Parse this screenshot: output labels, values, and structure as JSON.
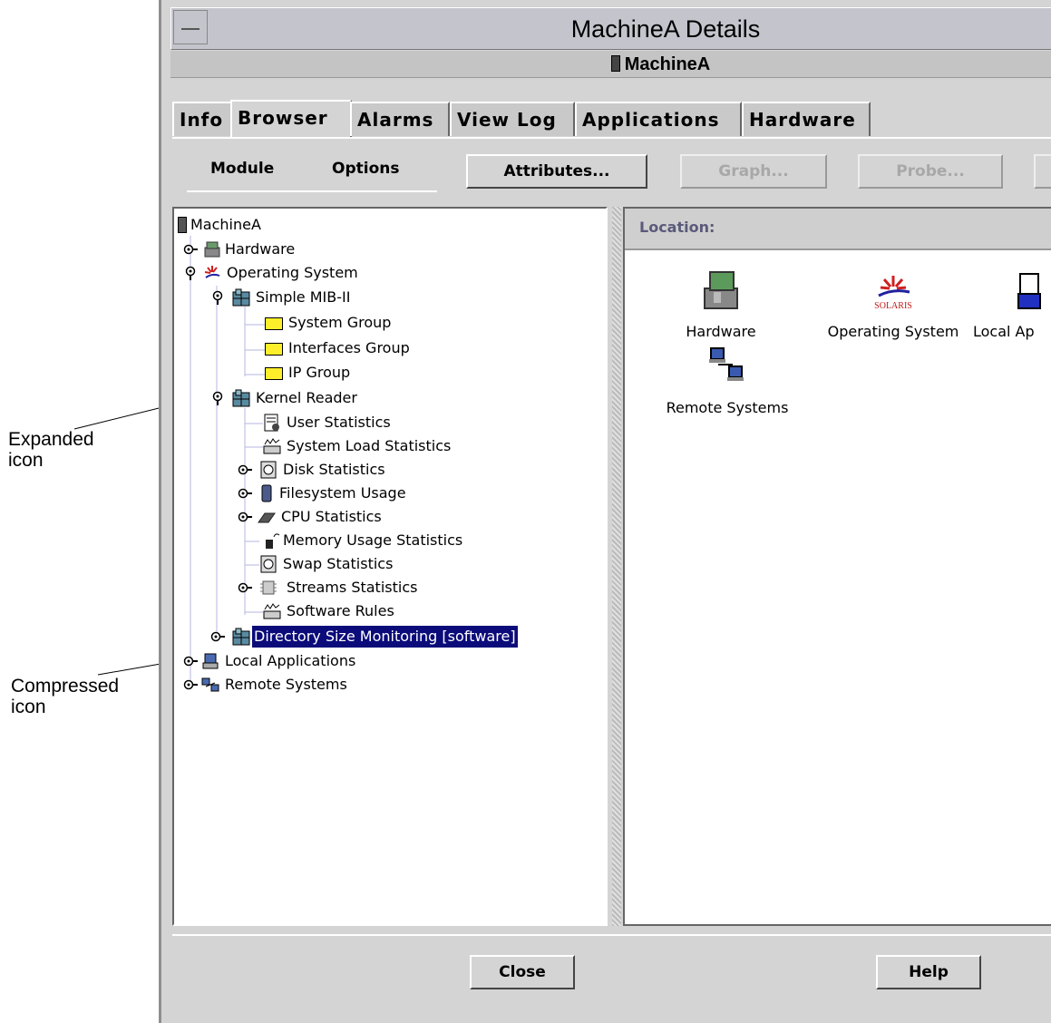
{
  "callouts": {
    "expanded": [
      "Expanded",
      "icon"
    ],
    "compressed": [
      "Compressed",
      "icon"
    ]
  },
  "window": {
    "title": "MachineA Details",
    "host": "MachineA"
  },
  "tabs": [
    "Info",
    "Browser",
    "Alarms",
    "View Log",
    "Applications",
    "Hardware"
  ],
  "active_tab": "Browser",
  "menus": [
    "Module",
    "Options"
  ],
  "toolbar": {
    "attributes": "Attributes...",
    "graph": "Graph...",
    "probe": "Probe..."
  },
  "tree": {
    "root": "MachineA",
    "hardware": "Hardware",
    "operating_system": "Operating System",
    "simple_mib": "Simple MIB-II",
    "system_group": "System Group",
    "interfaces_group": "Interfaces Group",
    "ip_group": "IP Group",
    "kernel_reader": "Kernel Reader",
    "user_statistics": "User Statistics",
    "system_load_statistics": "System Load Statistics",
    "disk_statistics": "Disk Statistics",
    "filesystem_usage": "Filesystem Usage",
    "cpu_statistics": "CPU Statistics",
    "memory_usage_statistics": "Memory Usage Statistics",
    "swap_statistics": "Swap Statistics",
    "streams_statistics": "Streams Statistics",
    "software_rules": "Software Rules",
    "directory_size_monitoring": "Directory Size Monitoring [software]",
    "local_applications": "Local Applications",
    "remote_systems": "Remote Systems"
  },
  "location": {
    "label": "Location:",
    "icons": {
      "hardware": "Hardware",
      "operating_system": "Operating System",
      "local_applications": "Local Ap",
      "remote_systems": "Remote Systems"
    },
    "solaris_logo": "SOLARIS"
  },
  "buttons": {
    "close": "Close",
    "help": "Help"
  },
  "colors": {
    "selection": "#0b0b7a",
    "window_bg": "#d4d4d4",
    "folder": "#ffef2a",
    "tree_guide": "#b4b4e0"
  },
  "icon_names": [
    "expanded-handle-icon",
    "collapsed-handle-icon",
    "folder-icon",
    "module-icon",
    "server-icon"
  ]
}
